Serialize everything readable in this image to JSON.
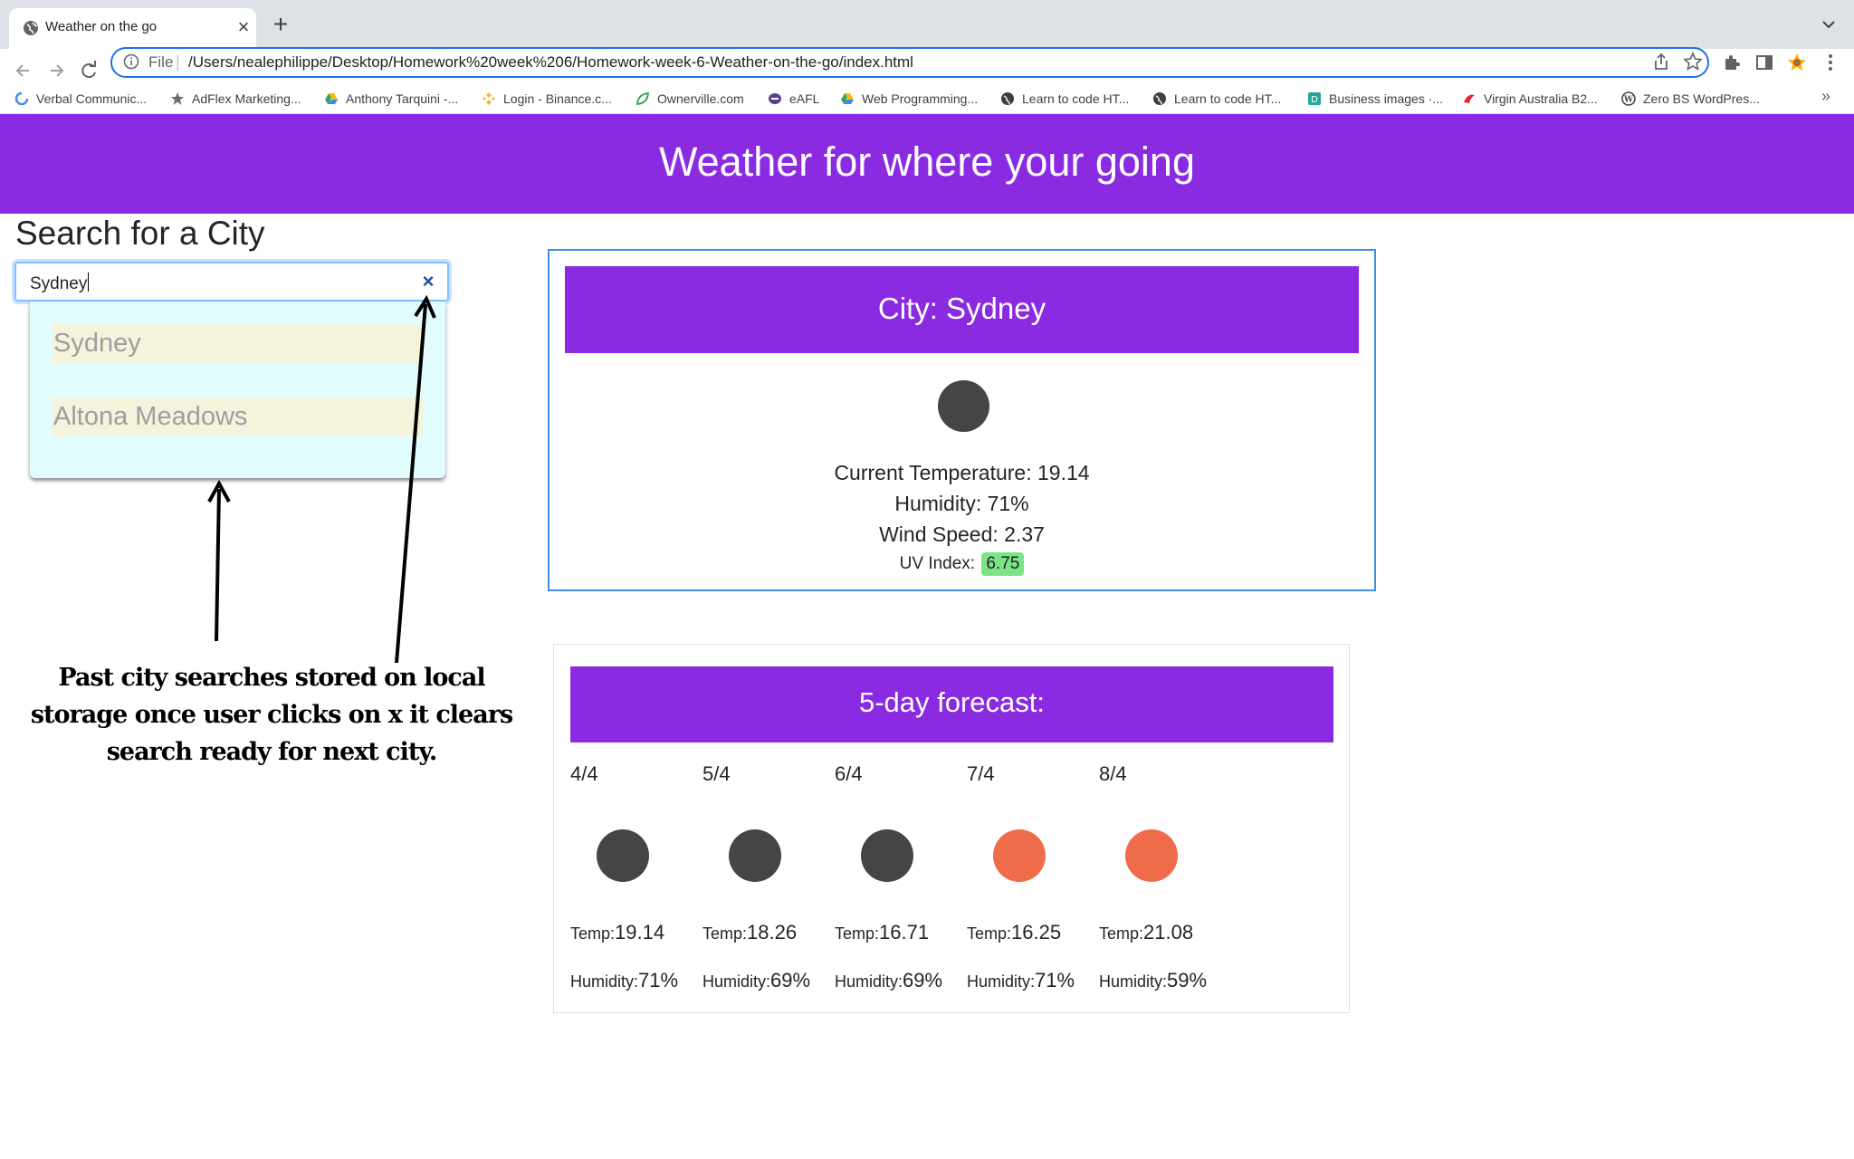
{
  "browser": {
    "tab_title": "Weather on the go",
    "tab_close": "×",
    "new_tab": "+",
    "url_scheme": "File",
    "url_separator": "|",
    "url": "/Users/nealephilippe/Desktop/Homework%20week%206/Homework-week-6-Weather-on-the-go/index.html",
    "bookmarks": [
      {
        "label": "Verbal Communic...",
        "icon": "blue-ring-icon"
      },
      {
        "label": "AdFlex Marketing...",
        "icon": "adflex-icon"
      },
      {
        "label": "Anthony Tarquini -...",
        "icon": "google-drive-icon"
      },
      {
        "label": "Login - Binance.c...",
        "icon": "binance-icon"
      },
      {
        "label": "Ownerville.com",
        "icon": "leaf-icon"
      },
      {
        "label": "eAFL",
        "icon": "afl-icon"
      },
      {
        "label": "Web Programming...",
        "icon": "google-drive-icon"
      },
      {
        "label": "Learn to code HT...",
        "icon": "globe-icon"
      },
      {
        "label": "Learn to code HT...",
        "icon": "globe-icon"
      },
      {
        "label": "Business images ·...",
        "icon": "d-icon"
      },
      {
        "label": "Virgin Australia B2...",
        "icon": "virgin-icon"
      },
      {
        "label": "Zero BS WordPres...",
        "icon": "wordpress-icon"
      }
    ],
    "bookmarks_more": "»"
  },
  "page": {
    "banner_title": "Weather for where your going",
    "search": {
      "title": "Search for a City",
      "value": "Sydney",
      "clear": "×",
      "history": [
        "Sydney",
        "Altona Meadows"
      ]
    },
    "annotation": "Past city searches stored on local storage once user clicks on x it clears search ready for next city.",
    "current": {
      "city_label": "City: Sydney",
      "icon_color": "#454545",
      "temperature": "Current Temperature: 19.14",
      "humidity": "Humidity: 71%",
      "wind": "Wind Speed: 2.37",
      "uv_label": "UV Index:",
      "uv_value": "6.75",
      "uv_color": "#7ce486"
    },
    "forecast": {
      "title": "5-day forecast:",
      "temp_label": "Temp:",
      "humidity_label": "Humidity:",
      "days": [
        {
          "date": "4/4",
          "temp": "19.14",
          "humidity": "71%",
          "icon_color": "#454545"
        },
        {
          "date": "5/4",
          "temp": "18.26",
          "humidity": "69%",
          "icon_color": "#454545"
        },
        {
          "date": "6/4",
          "temp": "16.71",
          "humidity": "69%",
          "icon_color": "#454545"
        },
        {
          "date": "7/4",
          "temp": "16.25",
          "humidity": "71%",
          "icon_color": "#ef6c4a"
        },
        {
          "date": "8/4",
          "temp": "21.08",
          "humidity": "59%",
          "icon_color": "#ef6c4a"
        }
      ]
    }
  },
  "colors": {
    "accent_purple": "#8a2be2",
    "card_border_blue": "#3c8fe6",
    "dropdown_bg": "#e2fdfd",
    "history_item_bg": "#f4f3dc"
  }
}
